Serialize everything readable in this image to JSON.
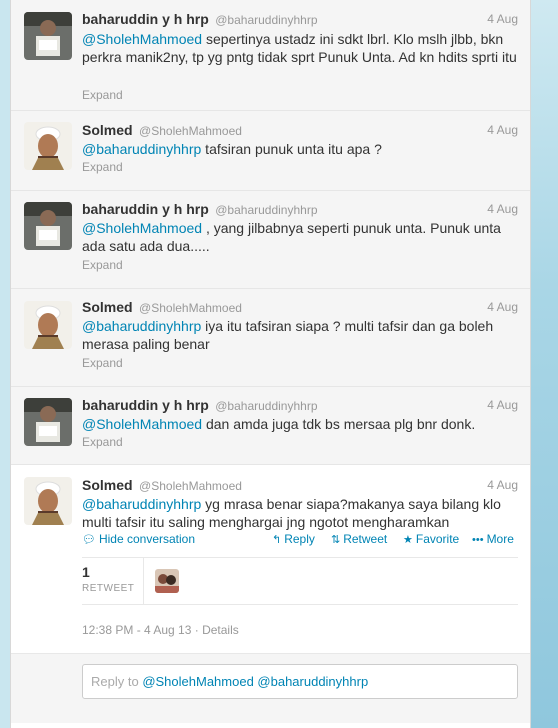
{
  "tweets": [
    {
      "fullname": "baharuddin y h hrp",
      "username": "@baharuddinyhhrp",
      "time": "4 Aug",
      "mention": "@SholehMahmoed",
      "text": "  sepertinya ustadz ini sdkt lbrl. Klo mslh jlbb, bkn perkra manik2ny, tp yg pntg tidak sprt Punuk Unta. Ad kn hdits sprti itu",
      "expand": "Expand"
    },
    {
      "fullname": "Solmed",
      "username": "@SholehMahmoed",
      "time": "4 Aug",
      "mention": "@baharuddinyhhrp",
      "text": " tafsiran punuk unta itu apa ?",
      "expand": "Expand"
    },
    {
      "fullname": "baharuddin y h hrp",
      "username": "@baharuddinyhhrp",
      "time": "4 Aug",
      "mention": "@SholehMahmoed",
      "text": " , yang jilbabnya seperti punuk unta. Punuk unta ada satu ada dua.....",
      "expand": "Expand"
    },
    {
      "fullname": "Solmed",
      "username": "@SholehMahmoed",
      "time": "4 Aug",
      "mention": "@baharuddinyhhrp",
      "text": " iya itu tafsiran siapa ? multi tafsir dan ga boleh merasa paling benar",
      "expand": "Expand"
    },
    {
      "fullname": "baharuddin y h hrp",
      "username": "@baharuddinyhhrp",
      "time": "4 Aug",
      "mention": "@SholehMahmoed",
      "text": " dan amda juga tdk bs mersaa plg bnr donk.",
      "expand": "Expand"
    }
  ],
  "expanded": {
    "fullname": "Solmed",
    "username": "@SholehMahmoed",
    "time": "4 Aug",
    "mention": "@baharuddinyhhrp",
    "text": " yg mrasa benar siapa?makanya saya bilang klo multi tafsir itu saling menghargai jng ngotot mengharamkan",
    "hide_conversation": "Hide conversation",
    "actions": {
      "reply": "Reply",
      "retweet": "Retweet",
      "favorite": "Favorite",
      "more": "More"
    },
    "retweet_count": "1",
    "retweet_label": "RETWEET",
    "timestamp": "12:38 PM - 4 Aug 13 · Details",
    "reply_placeholder_prefix": "Reply to ",
    "reply_mentions": "@SholehMahmoed @baharuddinyhhrp"
  },
  "colors": {
    "link": "#0084b4",
    "muted": "#999999",
    "text": "#333333"
  },
  "icons": {
    "hide": "speech-bubble-icon",
    "reply": "reply-arrow-icon",
    "retweet": "retweet-icon",
    "favorite": "star-icon",
    "more": "ellipsis-icon"
  }
}
